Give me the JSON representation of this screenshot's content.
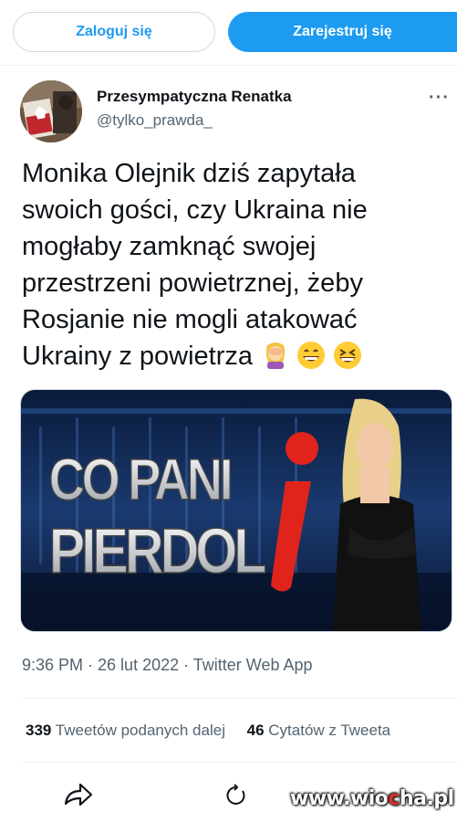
{
  "header": {
    "login_label": "Zaloguj się",
    "register_label": "Zarejestruj się"
  },
  "tweet": {
    "author_name": "Przesympatyczna Renatka",
    "author_handle": "@tylko_prawda_",
    "more_label": "···",
    "text_lines": [
      "Monika Olejnik dziś zapytała",
      "swoich gości, czy Ukraina nie",
      "mogłaby zamknąć swojej",
      "przestrzeni powietrznej, żeby",
      "Rosjanie nie mogli atakować",
      "Ukrainy z powietrza"
    ],
    "emojis": [
      "facepalm-woman",
      "grinning-face",
      "laughing-face"
    ],
    "image": {
      "line1": "CO PANI",
      "line2": "PIERDOL",
      "logo_letter": "i"
    },
    "timestamp": "9:36 PM · 26 lut 2022 · Twitter Web App",
    "retweets_count": "339",
    "retweets_label": "Tweetów podanych dalej",
    "quotes_count": "46",
    "quotes_label": "Cytatów z Tweeta"
  },
  "actions": {
    "icons": [
      "share-icon",
      "refresh-icon"
    ]
  },
  "watermark": {
    "text_pre": "www.wio",
    "text_accent": "c",
    "text_post": "ha.pl"
  },
  "colors": {
    "accent": "#1d9bf0",
    "text": "#0f1419",
    "muted": "#536471",
    "watermark_accent": "#e0312b"
  }
}
